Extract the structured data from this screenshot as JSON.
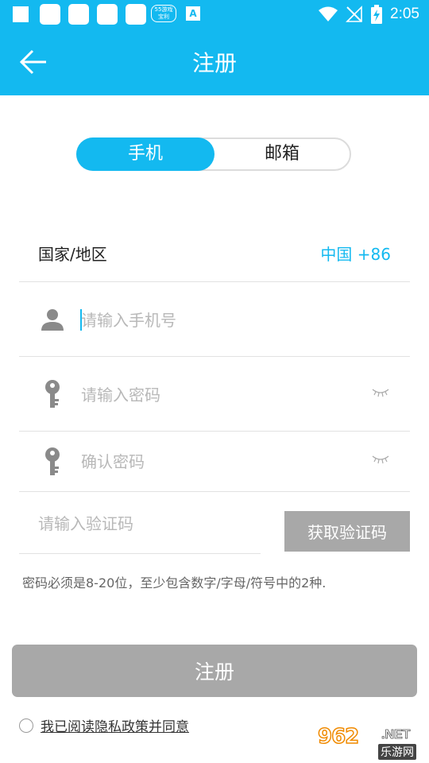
{
  "header": {
    "title": "注册",
    "background_color": "#13b9f0"
  },
  "statusbar": {
    "time": "2:05",
    "badge_text": "55游戏 宝利",
    "a_icon": "A"
  },
  "segment": {
    "phone_label": "手机",
    "email_label": "邮箱",
    "active": "phone"
  },
  "form": {
    "country_label": "国家/地区",
    "country_value": "中国 +86",
    "phone_placeholder": "请输入手机号",
    "password_placeholder": "请输入密码",
    "confirm_placeholder": "确认密码",
    "code_placeholder": "请输入验证码",
    "get_code_label": "获取验证码",
    "hint": "密码必须是8-20位，至少包含数字/字母/符号中的2种."
  },
  "actions": {
    "register_label": "注册"
  },
  "agreement": {
    "text": "我已阅读隐私政策并同意",
    "checked": false
  },
  "watermark": {
    "number": "962",
    "domain": ".NET",
    "site": "乐游网"
  },
  "colors": {
    "accent": "#13b9f0",
    "disabled_button": "#a8a8a8"
  }
}
